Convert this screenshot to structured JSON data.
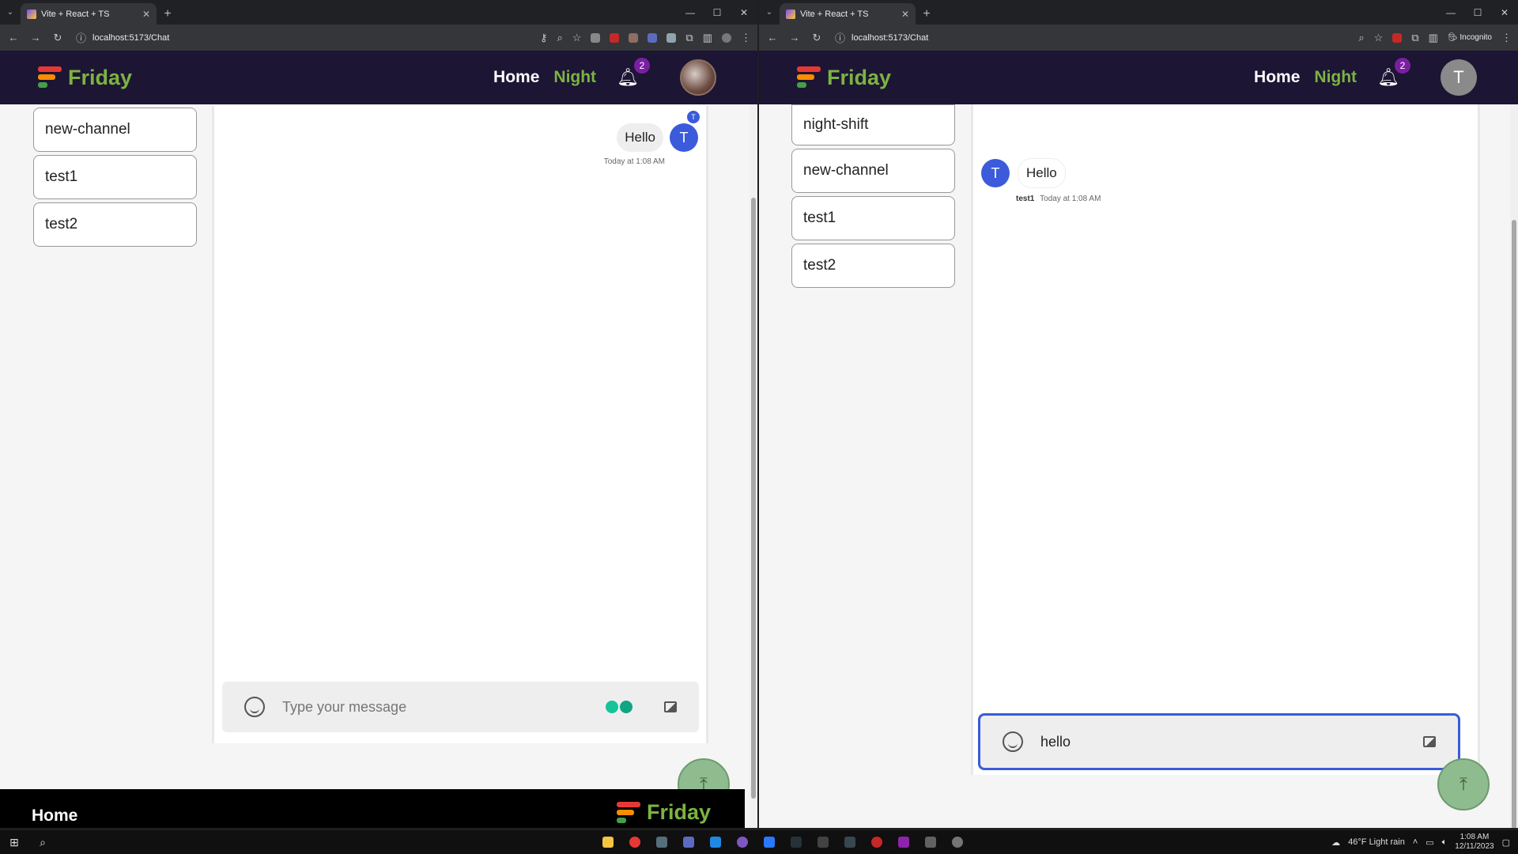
{
  "left_window": {
    "tab_title": "Vite + React + TS",
    "url": "localhost:5173/Chat",
    "brand": "Friday",
    "nav": {
      "home": "Home",
      "night": "Night",
      "notifications": "2"
    },
    "channels": [
      "new-channel",
      "test1",
      "test2"
    ],
    "message": {
      "text": "Hello",
      "avatar_letter": "T",
      "read_indicator": "T",
      "time": "Today at 1:08 AM"
    },
    "input_placeholder": "Type your message",
    "footer": {
      "home": "Home",
      "brand": "Friday"
    },
    "fab_symbol": "⤒"
  },
  "right_window": {
    "tab_title": "Vite + React + TS",
    "url": "localhost:5173/Chat",
    "incognito_label": "Incognito",
    "brand": "Friday",
    "nav": {
      "home": "Home",
      "night": "Night",
      "notifications": "2",
      "avatar_letter": "T"
    },
    "channels": [
      "night-shift",
      "new-channel",
      "test1",
      "test2"
    ],
    "message": {
      "text": "Hello",
      "avatar_letter": "T",
      "author": "test1",
      "time": "Today at 1:08 AM"
    },
    "input_value": "hello",
    "fab_symbol": "⤒"
  },
  "taskbar": {
    "weather": "46°F  Light rain",
    "time": "1:08 AM",
    "date": "12/11/2023"
  }
}
